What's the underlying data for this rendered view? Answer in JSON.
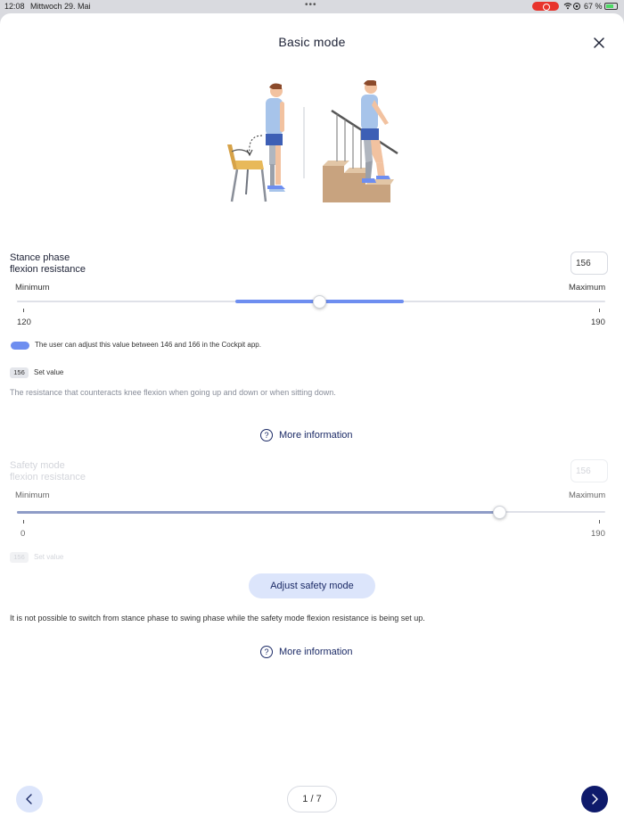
{
  "status_bar": {
    "time": "12:08",
    "date": "Mittwoch 29. Mai",
    "battery": "67 %"
  },
  "header": {
    "title": "Basic mode"
  },
  "stance": {
    "label_line1": "Stance phase",
    "label_line2": "flexion resistance",
    "value": "156",
    "min_label": "Minimum",
    "max_label": "Maximum",
    "min_value": "120",
    "max_value": "190",
    "range_low": 146,
    "range_high": 166,
    "current": 156,
    "legend_text": "The user can adjust this value between 146 and 166 in the Cockpit app.",
    "badge": "156",
    "set_value_label": "Set value",
    "description": "The resistance that counteracts knee flexion when going up and down or when sitting down.",
    "more_info": "More information"
  },
  "safety": {
    "label_line1": "Safety mode",
    "label_line2": "flexion resistance",
    "value": "156",
    "min_label": "Minimum",
    "max_label": "Maximum",
    "min_value": "0",
    "max_value": "190",
    "current": 156,
    "badge": "156",
    "set_value_label": "Set value",
    "adjust_button": "Adjust safety mode",
    "description": "It is not possible to switch from stance phase to swing phase while the safety mode flexion resistance is being set up.",
    "more_info": "More information"
  },
  "footer": {
    "pager": "1 / 7"
  },
  "colors": {
    "accent": "#6e8ef0",
    "primary_dark": "#0e1a6b",
    "button_light": "#dce5fb",
    "link": "#1b2a66"
  }
}
